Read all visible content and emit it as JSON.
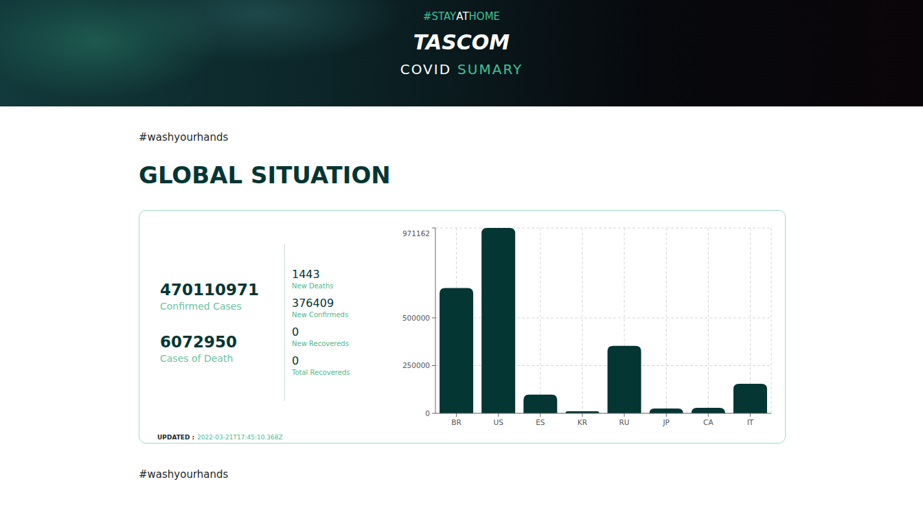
{
  "header": {
    "tag": [
      {
        "text": "#STAY",
        "accent": true
      },
      {
        "text": "AT",
        "accent": false
      },
      {
        "text": "HOME",
        "accent": true
      }
    ],
    "title": "TASCOM",
    "subtitle": [
      {
        "text": "COVID",
        "accent": false
      },
      {
        "text": "SUMARY",
        "accent": true
      }
    ]
  },
  "hashtag_top": "#washyourhands",
  "section_title": "GLOBAL SITUATION",
  "totals": [
    {
      "value": "470110971",
      "label": "Confirmed Cases"
    },
    {
      "value": "6072950",
      "label": "Cases of Death"
    }
  ],
  "daily": [
    {
      "value": "1443",
      "label": "New Deaths"
    },
    {
      "value": "376409",
      "label": "New Confirmeds"
    },
    {
      "value": "0",
      "label": "New Recovereds"
    },
    {
      "value": "0",
      "label": "Total Recovereds"
    }
  ],
  "chart": {
    "ticks": [
      "971162",
      "500000",
      "250000",
      "0"
    ],
    "categories": [
      "BR",
      "US",
      "ES",
      "KR",
      "RU",
      "JP",
      "CA",
      "IT"
    ],
    "values": [
      656000,
      971162,
      98000,
      11000,
      353000,
      25000,
      29000,
      155000
    ]
  },
  "updated": {
    "label": "UPDATED :",
    "value": "2022-03-21T17:45:10.368Z"
  },
  "hashtag_bottom": "#washyourhands"
}
